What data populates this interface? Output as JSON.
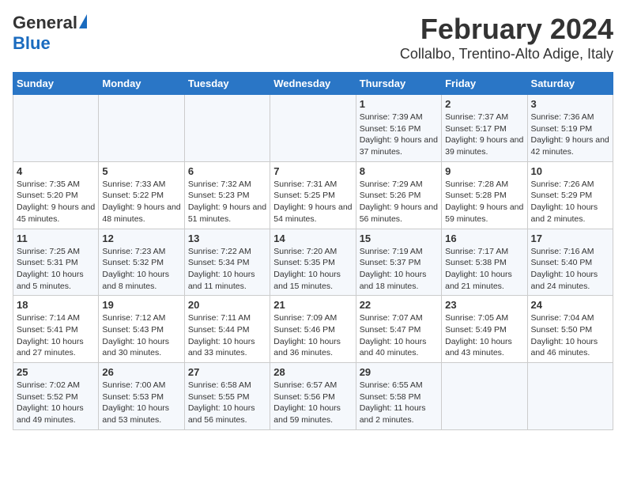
{
  "header": {
    "logo": {
      "general": "General",
      "blue": "Blue"
    },
    "title": "February 2024",
    "subtitle": "Collalbo, Trentino-Alto Adige, Italy"
  },
  "calendar": {
    "weekdays": [
      "Sunday",
      "Monday",
      "Tuesday",
      "Wednesday",
      "Thursday",
      "Friday",
      "Saturday"
    ],
    "weeks": [
      [
        {
          "day": "",
          "info": ""
        },
        {
          "day": "",
          "info": ""
        },
        {
          "day": "",
          "info": ""
        },
        {
          "day": "",
          "info": ""
        },
        {
          "day": "1",
          "info": "Sunrise: 7:39 AM\nSunset: 5:16 PM\nDaylight: 9 hours and 37 minutes."
        },
        {
          "day": "2",
          "info": "Sunrise: 7:37 AM\nSunset: 5:17 PM\nDaylight: 9 hours and 39 minutes."
        },
        {
          "day": "3",
          "info": "Sunrise: 7:36 AM\nSunset: 5:19 PM\nDaylight: 9 hours and 42 minutes."
        }
      ],
      [
        {
          "day": "4",
          "info": "Sunrise: 7:35 AM\nSunset: 5:20 PM\nDaylight: 9 hours and 45 minutes."
        },
        {
          "day": "5",
          "info": "Sunrise: 7:33 AM\nSunset: 5:22 PM\nDaylight: 9 hours and 48 minutes."
        },
        {
          "day": "6",
          "info": "Sunrise: 7:32 AM\nSunset: 5:23 PM\nDaylight: 9 hours and 51 minutes."
        },
        {
          "day": "7",
          "info": "Sunrise: 7:31 AM\nSunset: 5:25 PM\nDaylight: 9 hours and 54 minutes."
        },
        {
          "day": "8",
          "info": "Sunrise: 7:29 AM\nSunset: 5:26 PM\nDaylight: 9 hours and 56 minutes."
        },
        {
          "day": "9",
          "info": "Sunrise: 7:28 AM\nSunset: 5:28 PM\nDaylight: 9 hours and 59 minutes."
        },
        {
          "day": "10",
          "info": "Sunrise: 7:26 AM\nSunset: 5:29 PM\nDaylight: 10 hours and 2 minutes."
        }
      ],
      [
        {
          "day": "11",
          "info": "Sunrise: 7:25 AM\nSunset: 5:31 PM\nDaylight: 10 hours and 5 minutes."
        },
        {
          "day": "12",
          "info": "Sunrise: 7:23 AM\nSunset: 5:32 PM\nDaylight: 10 hours and 8 minutes."
        },
        {
          "day": "13",
          "info": "Sunrise: 7:22 AM\nSunset: 5:34 PM\nDaylight: 10 hours and 11 minutes."
        },
        {
          "day": "14",
          "info": "Sunrise: 7:20 AM\nSunset: 5:35 PM\nDaylight: 10 hours and 15 minutes."
        },
        {
          "day": "15",
          "info": "Sunrise: 7:19 AM\nSunset: 5:37 PM\nDaylight: 10 hours and 18 minutes."
        },
        {
          "day": "16",
          "info": "Sunrise: 7:17 AM\nSunset: 5:38 PM\nDaylight: 10 hours and 21 minutes."
        },
        {
          "day": "17",
          "info": "Sunrise: 7:16 AM\nSunset: 5:40 PM\nDaylight: 10 hours and 24 minutes."
        }
      ],
      [
        {
          "day": "18",
          "info": "Sunrise: 7:14 AM\nSunset: 5:41 PM\nDaylight: 10 hours and 27 minutes."
        },
        {
          "day": "19",
          "info": "Sunrise: 7:12 AM\nSunset: 5:43 PM\nDaylight: 10 hours and 30 minutes."
        },
        {
          "day": "20",
          "info": "Sunrise: 7:11 AM\nSunset: 5:44 PM\nDaylight: 10 hours and 33 minutes."
        },
        {
          "day": "21",
          "info": "Sunrise: 7:09 AM\nSunset: 5:46 PM\nDaylight: 10 hours and 36 minutes."
        },
        {
          "day": "22",
          "info": "Sunrise: 7:07 AM\nSunset: 5:47 PM\nDaylight: 10 hours and 40 minutes."
        },
        {
          "day": "23",
          "info": "Sunrise: 7:05 AM\nSunset: 5:49 PM\nDaylight: 10 hours and 43 minutes."
        },
        {
          "day": "24",
          "info": "Sunrise: 7:04 AM\nSunset: 5:50 PM\nDaylight: 10 hours and 46 minutes."
        }
      ],
      [
        {
          "day": "25",
          "info": "Sunrise: 7:02 AM\nSunset: 5:52 PM\nDaylight: 10 hours and 49 minutes."
        },
        {
          "day": "26",
          "info": "Sunrise: 7:00 AM\nSunset: 5:53 PM\nDaylight: 10 hours and 53 minutes."
        },
        {
          "day": "27",
          "info": "Sunrise: 6:58 AM\nSunset: 5:55 PM\nDaylight: 10 hours and 56 minutes."
        },
        {
          "day": "28",
          "info": "Sunrise: 6:57 AM\nSunset: 5:56 PM\nDaylight: 10 hours and 59 minutes."
        },
        {
          "day": "29",
          "info": "Sunrise: 6:55 AM\nSunset: 5:58 PM\nDaylight: 11 hours and 2 minutes."
        },
        {
          "day": "",
          "info": ""
        },
        {
          "day": "",
          "info": ""
        }
      ]
    ]
  }
}
